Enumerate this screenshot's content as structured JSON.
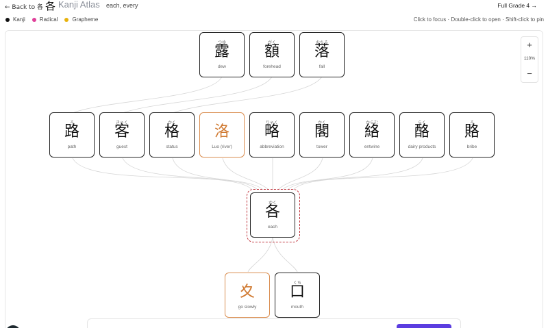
{
  "header": {
    "back_label": "← Back to 各",
    "title_kanji": "各",
    "title": "Kanji Atlas",
    "subtitle": "each, every",
    "grade_label": "Full Grade 4 →"
  },
  "legend": [
    {
      "label": "Kanji",
      "color": "#111111"
    },
    {
      "label": "Radical",
      "color": "#e0409a"
    },
    {
      "label": "Grapheme",
      "color": "#e8b20c"
    }
  ],
  "hint": "Click to focus · Double-click to open · Shift-click to pin",
  "zoom": {
    "plus": "+",
    "minus": "−",
    "level": "110%"
  },
  "colors": {
    "accent_orange": "#d07a32",
    "focus_ring": "#c0313a",
    "primary_button": "#5b3de0"
  },
  "nodes": {
    "top": [
      {
        "kanji": "露",
        "reading": "つゆ",
        "meaning": "dew"
      },
      {
        "kanji": "額",
        "reading": "がく",
        "meaning": "forehead"
      },
      {
        "kanji": "落",
        "reading": "おちる",
        "meaning": "fall"
      }
    ],
    "middle": [
      {
        "kanji": "路",
        "reading": "ろ",
        "meaning": "path"
      },
      {
        "kanji": "客",
        "reading": "きゃく",
        "meaning": "guest"
      },
      {
        "kanji": "格",
        "reading": "かく",
        "meaning": "status"
      },
      {
        "kanji": "洛",
        "reading": "",
        "meaning": "Luo (river)"
      },
      {
        "kanji": "略",
        "reading": "りゃく",
        "meaning": "abbreviation"
      },
      {
        "kanji": "閣",
        "reading": "かく",
        "meaning": "tower"
      },
      {
        "kanji": "絡",
        "reading": "からむ",
        "meaning": "entwine"
      },
      {
        "kanji": "酪",
        "reading": "らく",
        "meaning": "dairy products"
      },
      {
        "kanji": "賂",
        "reading": "ろ",
        "meaning": "bribe"
      }
    ],
    "focus": {
      "kanji": "各",
      "reading": "かく",
      "meaning": "each"
    },
    "bottom": [
      {
        "kanji": "夊",
        "reading": "",
        "meaning": "go slowly"
      },
      {
        "kanji": "口",
        "reading": "くち",
        "meaning": "mouth"
      }
    ]
  }
}
